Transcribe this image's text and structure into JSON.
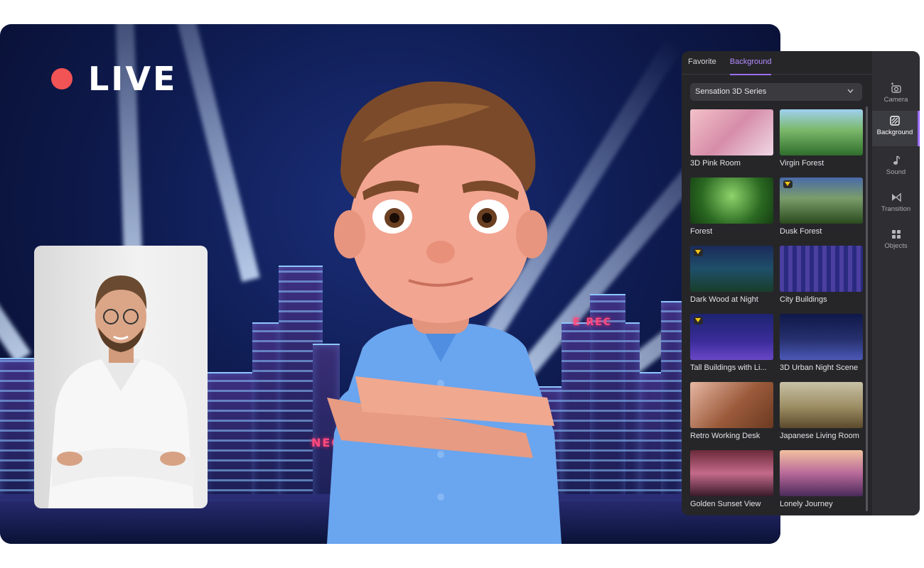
{
  "stage": {
    "live_label": "LIVE",
    "sign_left": "E REC",
    "sign_bottom": "NEO CI"
  },
  "panel": {
    "tabs": [
      {
        "label": "Favorite",
        "active": false
      },
      {
        "label": "Background",
        "active": true
      }
    ],
    "dropdown": {
      "selected": "Sensation 3D Series"
    },
    "backgrounds": [
      {
        "label": "3D Pink Room",
        "premium": false
      },
      {
        "label": "Virgin Forest",
        "premium": false
      },
      {
        "label": "Forest",
        "premium": false
      },
      {
        "label": "Dusk Forest",
        "premium": true
      },
      {
        "label": "Dark Wood at Night",
        "premium": true
      },
      {
        "label": "City Buildings",
        "premium": false
      },
      {
        "label": "Tall Buildings with Li...",
        "premium": true
      },
      {
        "label": "3D Urban Night Scene",
        "premium": false
      },
      {
        "label": "Retro Working Desk",
        "premium": false
      },
      {
        "label": "Japanese Living Room",
        "premium": false
      },
      {
        "label": "Golden Sunset View",
        "premium": false
      },
      {
        "label": "Lonely Journey",
        "premium": false
      }
    ]
  },
  "rail": {
    "items": [
      {
        "label": "Camera",
        "icon": "camera-icon",
        "active": false
      },
      {
        "label": "Background",
        "icon": "background-icon",
        "active": true
      },
      {
        "label": "Sound",
        "icon": "music-note-icon",
        "active": false
      },
      {
        "label": "Transition",
        "icon": "transition-icon",
        "active": false
      },
      {
        "label": "Objects",
        "icon": "objects-grid-icon",
        "active": false
      }
    ]
  },
  "colors": {
    "accent": "#9d6cff",
    "live_dot": "#f25355",
    "panel_bg": "#262629",
    "premium_badge": "#f5c518"
  }
}
